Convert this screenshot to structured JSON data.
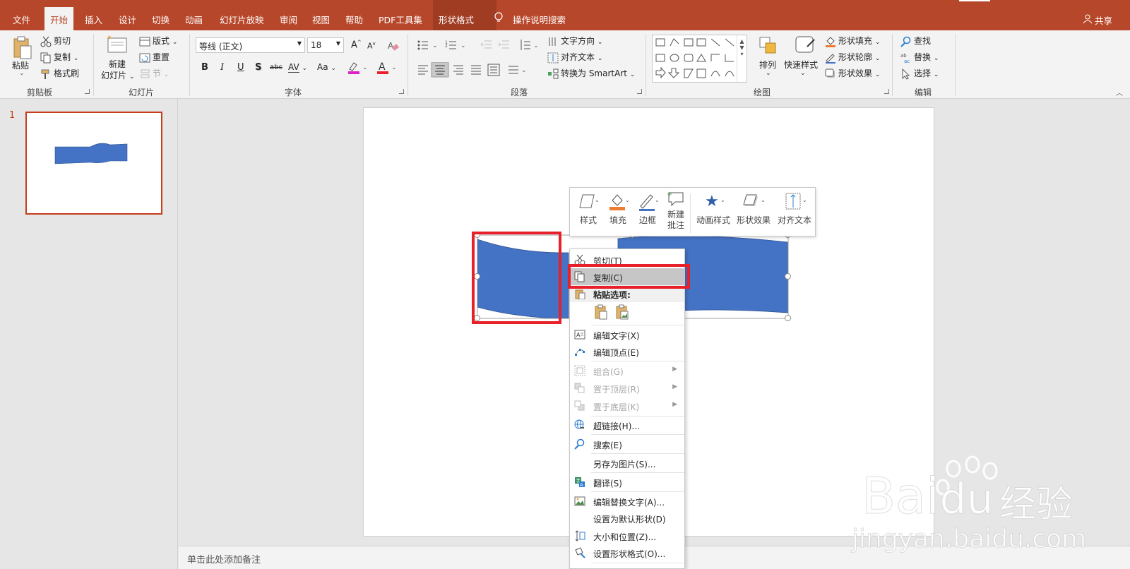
{
  "tabs": [
    {
      "label": "文件"
    },
    {
      "label": "开始"
    },
    {
      "label": "插入"
    },
    {
      "label": "设计"
    },
    {
      "label": "切换"
    },
    {
      "label": "动画"
    },
    {
      "label": "幻灯片放映"
    },
    {
      "label": "审阅"
    },
    {
      "label": "视图"
    },
    {
      "label": "帮助"
    },
    {
      "label": "PDF工具集"
    },
    {
      "label": "形状格式"
    }
  ],
  "tell_me": "操作说明搜索",
  "share": "共享",
  "clipboard": {
    "paste": "粘贴",
    "cut": "剪切",
    "copy": "复制",
    "format_painter": "格式刷",
    "label": "剪贴板"
  },
  "slides": {
    "new_slide_line1": "新建",
    "new_slide_line2": "幻灯片",
    "layout": "版式",
    "reset": "重置",
    "section": "节",
    "label": "幻灯片"
  },
  "font": {
    "name": "等线 (正文)",
    "size": "18",
    "label": "字体",
    "bold": "B",
    "italic": "I",
    "underline": "U",
    "shadow": "S",
    "strike": "abc",
    "spacing": "AV",
    "case": "Aa",
    "grow": "A",
    "shrink": "A"
  },
  "paragraph": {
    "text_direction": "文字方向",
    "align_text": "对齐文本",
    "smartart": "转换为 SmartArt",
    "label": "段落"
  },
  "drawing": {
    "arrange": "排列",
    "quick_styles": "快速样式",
    "shape_fill": "形状填充",
    "shape_outline": "形状轮廓",
    "shape_effects": "形状效果",
    "label": "绘图"
  },
  "editing": {
    "find": "查找",
    "replace": "替换",
    "select": "选择",
    "label": "编辑"
  },
  "thumb": {
    "number": "1"
  },
  "notes_placeholder": "单击此处添加备注",
  "mini_toolbar": {
    "style": "样式",
    "fill": "填充",
    "border": "边框",
    "new_comment_line1": "新建",
    "new_comment_line2": "批注",
    "anim_style": "动画样式",
    "shape_effect": "形状效果",
    "align_text": "对齐文本"
  },
  "context_menu": {
    "cut": "剪切(T)",
    "copy": "复制(C)",
    "paste_options": "粘贴选项:",
    "edit_text": "编辑文字(X)",
    "edit_points": "编辑顶点(E)",
    "group": "组合(G)",
    "bring_front": "置于顶层(R)",
    "send_back": "置于底层(K)",
    "hyperlink": "超链接(H)...",
    "search": "搜索(E)",
    "save_as_picture": "另存为图片(S)...",
    "translate": "翻译(S)",
    "edit_alt_text": "编辑替换文字(A)...",
    "set_default": "设置为默认形状(D)",
    "size_position": "大小和位置(Z)...",
    "format_shape": "设置形状格式(O)..."
  },
  "watermark": {
    "brand": "Bai",
    "brand2": "du",
    "cn": "经验",
    "url": "jingyan.baidu.com"
  },
  "colors": {
    "accent": "#b7472a",
    "shape": "#4472c4",
    "highlight": "#e8202a"
  }
}
